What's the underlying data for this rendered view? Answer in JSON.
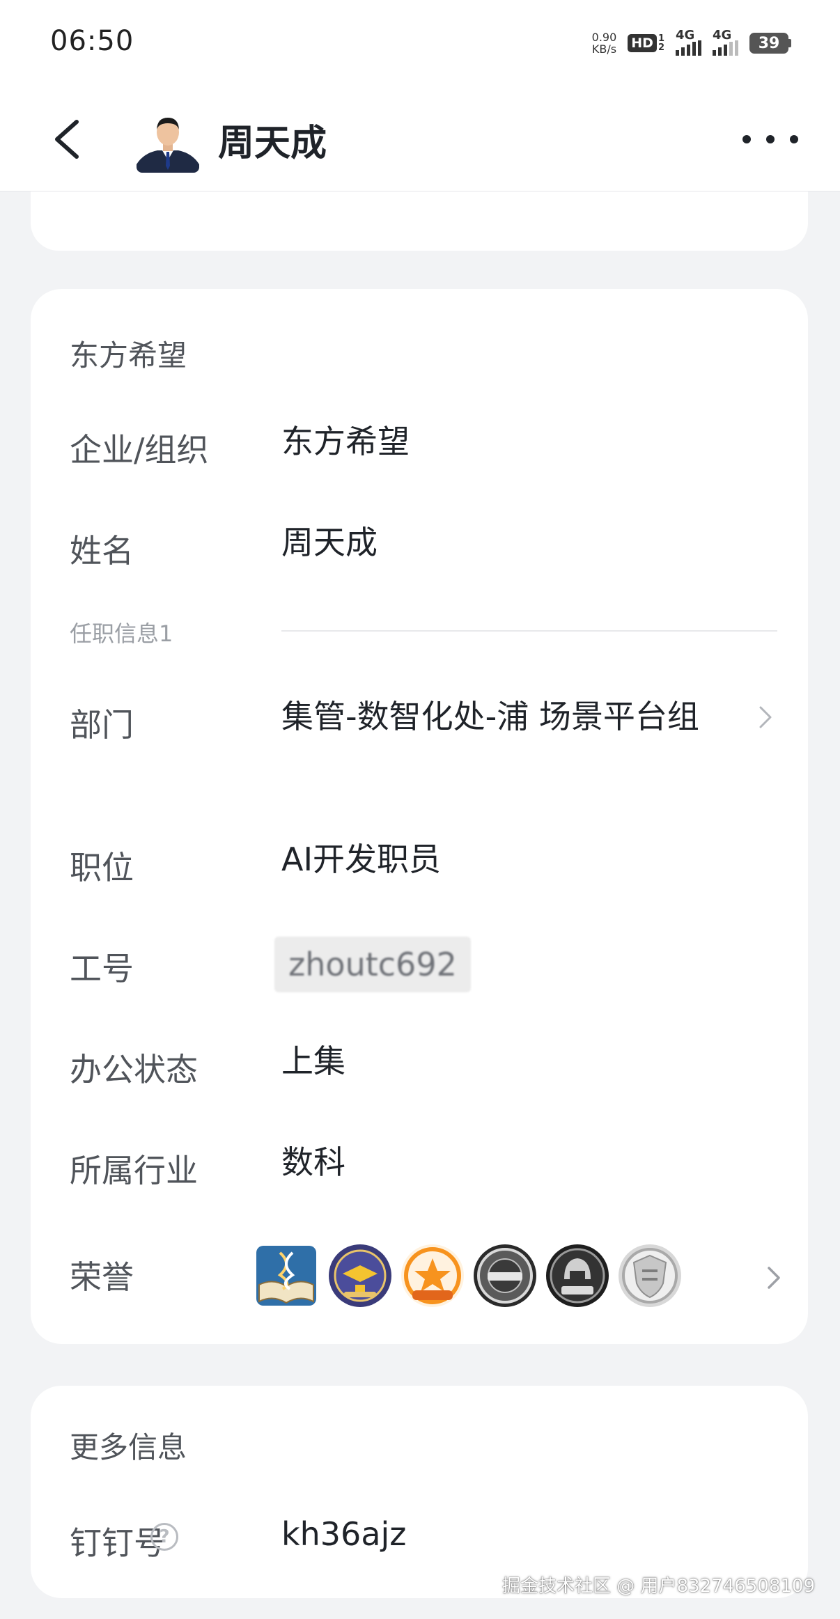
{
  "status_bar": {
    "time": "06:50",
    "net_speed_value": "0.90",
    "net_speed_unit": "KB/s",
    "hd_label": "HD",
    "hd_sub_top": "1",
    "hd_sub_bottom": "2",
    "signal1_label": "4G",
    "signal2_label": "4G",
    "battery": "39"
  },
  "header": {
    "title": "周天成"
  },
  "profile": {
    "org_section_title": "东方希望",
    "fields": {
      "org_label": "企业/组织",
      "org_value": "东方希望",
      "name_label": "姓名",
      "name_value": "周天成",
      "employment_label": "任职信息1",
      "department_label": "部门",
      "department_value": "集管-数智化处-浦 场景平台组",
      "position_label": "职位",
      "position_value": "AI开发职员",
      "employee_id_label": "工号",
      "employee_id_value": "zhoutc692",
      "office_status_label": "办公状态",
      "office_status_value": "上集",
      "industry_label": "所属行业",
      "industry_value": "数科",
      "honors_label": "荣誉"
    },
    "honor_badges": [
      "book-dna-badge",
      "graduation-badge",
      "orange-star-badge",
      "silver-ring-badge",
      "dark-helmet-badge",
      "silver-shield-badge"
    ]
  },
  "more_info": {
    "section_title": "更多信息",
    "dingtalk_label": "钉钉号",
    "dingtalk_value": "kh36ajz"
  },
  "watermark": "掘金技术社区 @ 用户832746508109",
  "colors": {
    "background": "#f2f3f5",
    "card": "#ffffff",
    "label": "#50545a",
    "value": "#1f2329"
  }
}
